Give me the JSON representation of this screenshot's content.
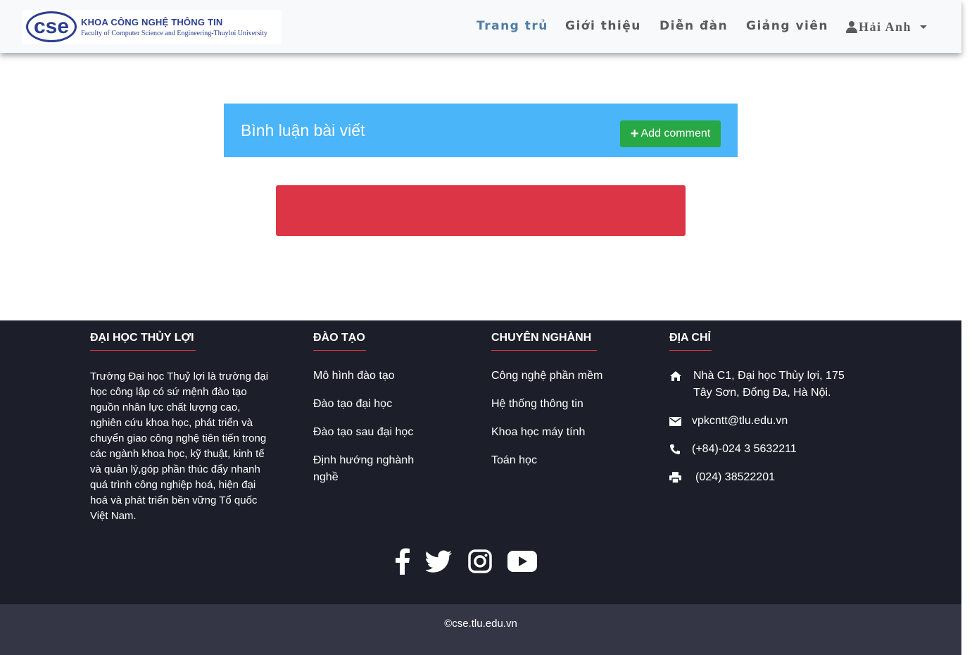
{
  "header": {
    "logo": {
      "mark": "cse",
      "line1": "KHOA CÔNG NGHỆ THÔNG TIN",
      "line2": "Faculty of Computer Science and Engineering-Thuyloi University"
    },
    "nav": [
      {
        "label": "Trang trủ",
        "active": true
      },
      {
        "label": "Giới thiệu",
        "active": false
      },
      {
        "label": "Diễn đàn",
        "active": false
      },
      {
        "label": "Giảng viên",
        "active": false
      }
    ],
    "user": {
      "name": "Hải Anh",
      "icon": "user-icon"
    }
  },
  "comments": {
    "title": "Bình luận bài viết",
    "add_button": "Add comment",
    "add_icon": "plus-icon"
  },
  "footer": {
    "col1": {
      "title": "ĐẠI HỌC THỦY LỢI",
      "text": "Trường Đại học Thuỷ lợi là trường đại học công lập có sứ mệnh đào tạo nguồn nhân lực chất lượng cao, nghiên cứu khoa học, phát triển và chuyển giao công nghệ tiên tiến trong các ngành khoa học, kỹ thuật, kinh tế và quản lý,góp phần thúc đẩy nhanh quá trình công nghiệp hoá, hiện đại hoá và phát triển bền vững Tổ quốc Việt Nam."
    },
    "col2": {
      "title": "ĐÀO TẠO",
      "links": [
        "Mô hình đào tạo",
        "Đào tạo đại học",
        "Đào tạo sau đại học",
        "Định hướng nghành nghề"
      ]
    },
    "col3": {
      "title": "CHUYÊN NGHÀNH",
      "links": [
        "Công nghệ phần mềm",
        "Hệ thống thông tin",
        "Khoa học máy tính",
        "Toán học"
      ]
    },
    "col4": {
      "title": "ĐỊA CHỈ",
      "address": "Nhà C1, Đại học Thủy lợi, 175 Tây Sơn, Đống Đa, Hà Nội.",
      "email": "vpkcntt@tlu.edu.vn",
      "phone": "(+84)-024 3 5632211",
      "fax": "(024) 38522201"
    },
    "social": [
      "facebook-icon",
      "twitter-icon",
      "instagram-icon",
      "youtube-icon"
    ],
    "copyright": "©cse.tlu.edu.vn"
  },
  "colors": {
    "accent_blue": "#4ab5f8",
    "button_green": "#28a745",
    "alert_red": "#dc3545",
    "footer_bg": "#1c1f29",
    "copyright_bg": "#343646"
  }
}
